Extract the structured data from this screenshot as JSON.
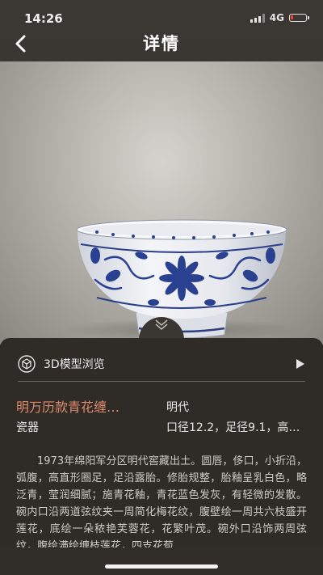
{
  "status_bar": {
    "time": "14:26",
    "network": "4G",
    "battery_level": 0.15,
    "battery_color": "#ff3b30"
  },
  "nav": {
    "title": "详情",
    "back_icon": "chevron-left-icon"
  },
  "hero": {
    "icon": "collapse-chevron-icon"
  },
  "model_viewer": {
    "label": "3D模型浏览",
    "icon": "cube-icon",
    "arrow_icon": "play-arrow-icon"
  },
  "artifact": {
    "name": "明万历款青花缠…",
    "category": "瓷器",
    "dynasty": "明代",
    "dimensions": "口径12.2，足径9.1，高…",
    "description": "1973年绵阳军分区明代窖藏出土。圆唇，侈口，小折沿，弧腹，高直形圈足，足沿露胎。修胎规整，胎釉呈乳白色，略泛青，莹润细腻；施青花釉，青花蓝色发灰，有轻微的发散。碗内口沿两道弦纹夹一周简化梅花纹，腹壁绘一周共六枝盛开莲花，底绘一朵秾艳芙蓉花，花繁叶茂。碗外口沿饰两周弦纹，腹绘满绘缠枝莲花，四支花苞"
  },
  "colors": {
    "accent": "#e0896a",
    "sheet_bg": "#2f2c28"
  }
}
